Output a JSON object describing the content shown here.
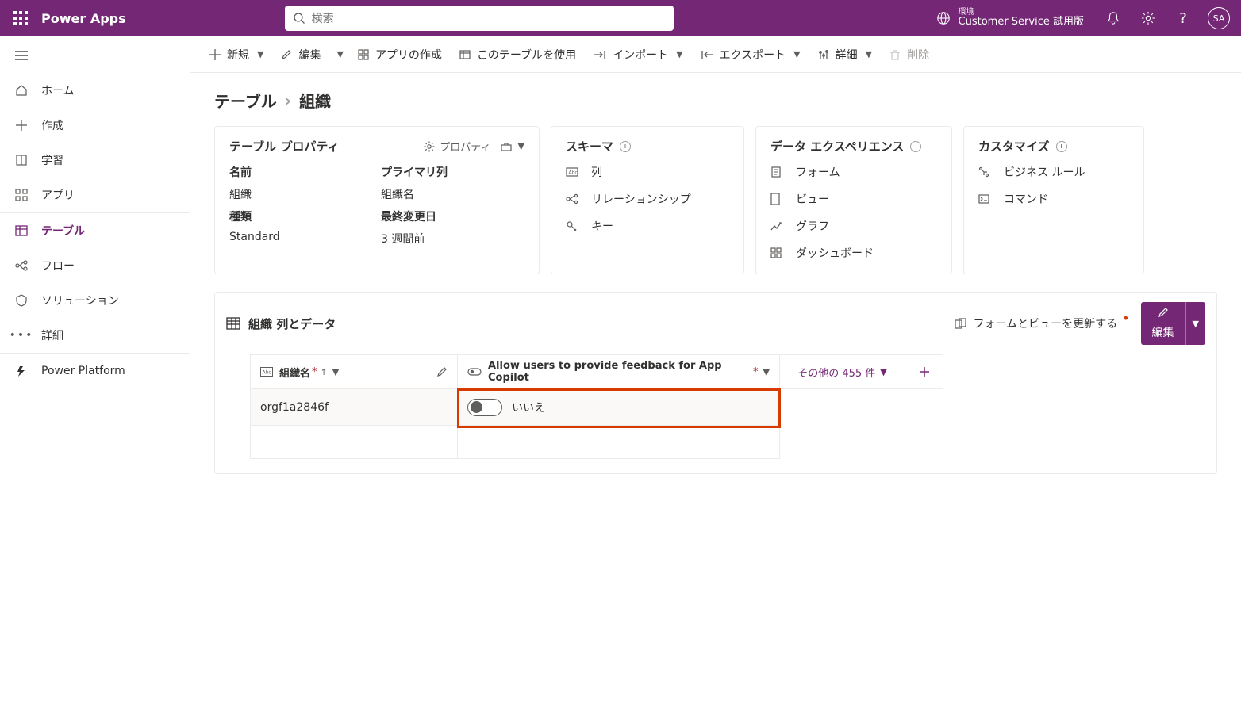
{
  "header": {
    "app_name": "Power Apps",
    "search_placeholder": "検索",
    "env_label": "環境",
    "env_value": "Customer Service 試用版",
    "avatar_initials": "SA"
  },
  "nav": {
    "home": "ホーム",
    "create": "作成",
    "learn": "学習",
    "apps": "アプリ",
    "tables": "テーブル",
    "flows": "フロー",
    "solutions": "ソリューション",
    "more": "詳細",
    "power_platform": "Power Platform"
  },
  "commands": {
    "new": "新規",
    "edit": "編集",
    "create_app": "アプリの作成",
    "use_table": "このテーブルを使用",
    "import": "インポート",
    "export": "エクスポート",
    "details": "詳細",
    "delete": "削除"
  },
  "breadcrumb": {
    "root": "テーブル",
    "current": "組織"
  },
  "propcard": {
    "title": "テーブル プロパティ",
    "action_properties": "プロパティ",
    "label_name": "名前",
    "value_name": "組織",
    "label_primary": "プライマリ列",
    "value_primary": "組織名",
    "label_kind": "種類",
    "value_kind": "Standard",
    "label_modified": "最終変更日",
    "value_modified": "3 週間前"
  },
  "schemacard": {
    "title": "スキーマ",
    "columns": "列",
    "relationships": "リレーションシップ",
    "keys": "キー"
  },
  "dataexpcard": {
    "title": "データ エクスペリエンス",
    "forms": "フォーム",
    "views": "ビュー",
    "charts": "グラフ",
    "dashboards": "ダッシュボード"
  },
  "customcard": {
    "title": "カスタマイズ",
    "business_rules": "ビジネス ルール",
    "commands": "コマンド"
  },
  "datasection": {
    "title": "組織 列とデータ",
    "update_forms_views": "フォームとビューを更新する",
    "edit_button": "編集",
    "col_name_header": "組織名",
    "col_allow_header": "Allow users to provide feedback for App Copilot",
    "other_columns": "その他の 455 件",
    "row_name_value": "orgf1a2846f",
    "toggle_text": "いいえ"
  }
}
